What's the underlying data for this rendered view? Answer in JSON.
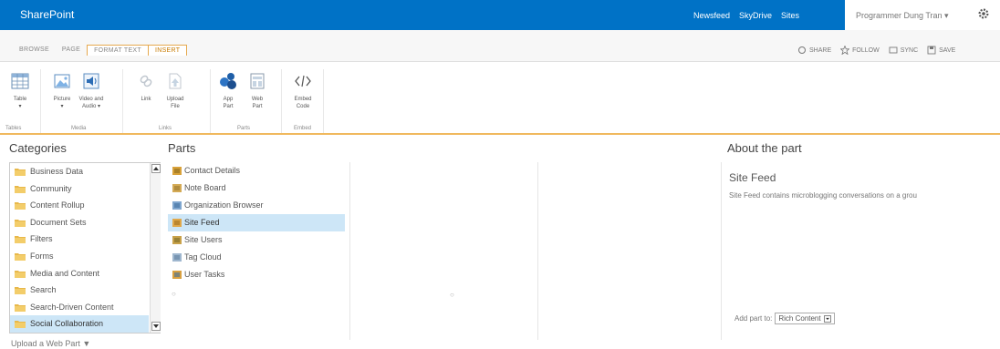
{
  "suite_bar": {
    "brand": "SharePoint",
    "links": [
      "Newsfeed",
      "SkyDrive",
      "Sites"
    ],
    "user": "Programmer Dung Tran ▾"
  },
  "ribbon_tabs": [
    "BROWSE",
    "PAGE",
    "FORMAT TEXT",
    "INSERT"
  ],
  "ribbon_actions": [
    "SHARE",
    "FOLLOW",
    "SYNC",
    "SAVE"
  ],
  "ribbon_groups": {
    "tables": {
      "label": "Tables",
      "buttons": [
        {
          "label": "Table",
          "sub": "▾"
        }
      ]
    },
    "media": {
      "label": "Media",
      "buttons": [
        {
          "label": "Picture",
          "sub": "▾"
        },
        {
          "label": "Video and",
          "sub": "Audio ▾"
        }
      ]
    },
    "links": {
      "label": "Links",
      "buttons": [
        {
          "label": "Link",
          "sub": ""
        },
        {
          "label": "Upload",
          "sub": "File"
        }
      ]
    },
    "parts": {
      "label": "Parts",
      "buttons": [
        {
          "label": "App",
          "sub": "Part"
        },
        {
          "label": "Web",
          "sub": "Part"
        }
      ]
    },
    "embed": {
      "label": "Embed",
      "buttons": [
        {
          "label": "Embed",
          "sub": "Code"
        }
      ]
    }
  },
  "headers": {
    "categories": "Categories",
    "parts": "Parts",
    "about": "About the part"
  },
  "categories": [
    "Business Data",
    "Community",
    "Content Rollup",
    "Document Sets",
    "Filters",
    "Forms",
    "Media and Content",
    "Search",
    "Search-Driven Content",
    "Social Collaboration"
  ],
  "selected_category_index": 9,
  "upload_label": "Upload a Web Part ▼",
  "parts": [
    {
      "label": "Contact Details",
      "icon": "contact-icon",
      "selected": false
    },
    {
      "label": "Note Board",
      "icon": "note-icon",
      "selected": false
    },
    {
      "label": "Organization Browser",
      "icon": "org-icon",
      "selected": false
    },
    {
      "label": "Site Feed",
      "icon": "feed-icon",
      "selected": true
    },
    {
      "label": "Site Users",
      "icon": "users-icon",
      "selected": false
    },
    {
      "label": "Tag Cloud",
      "icon": "tag-icon",
      "selected": false
    },
    {
      "label": "User Tasks",
      "icon": "tasks-icon",
      "selected": false
    }
  ],
  "about": {
    "title": "Site Feed",
    "description": "Site Feed contains microblogging conversations on a grou",
    "add_part_label": "Add part to:",
    "add_part_value": "Rich Content"
  },
  "colors": {
    "suite_bar": "#0072c6",
    "accent_orange": "#e6a94e",
    "selection": "#cde6f7"
  }
}
